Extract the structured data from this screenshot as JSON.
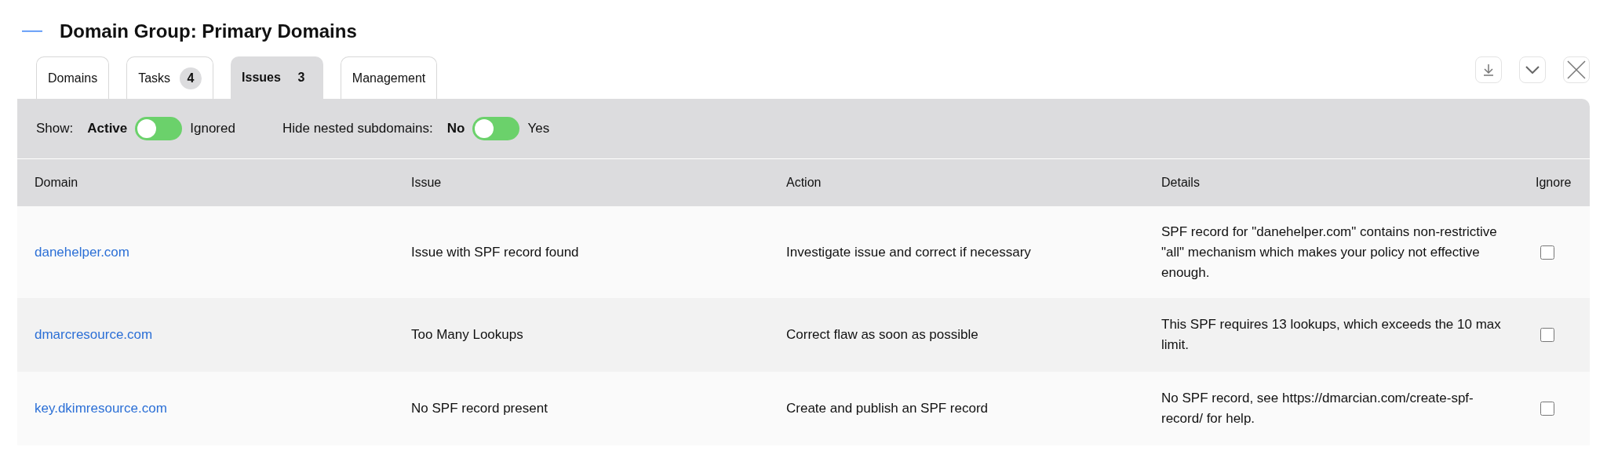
{
  "header": {
    "title": "Domain Group: Primary Domains"
  },
  "tabs": [
    {
      "label": "Domains",
      "selected": false
    },
    {
      "label": "Tasks",
      "count": "4",
      "selected": false
    },
    {
      "label": "Issues",
      "count": "3",
      "selected": true
    },
    {
      "label": "Management",
      "selected": false
    }
  ],
  "filters": [
    {
      "label": "Show:",
      "options": [
        {
          "label": "Active",
          "selected": true
        },
        {
          "label": "Ignored",
          "selected": false
        }
      ]
    },
    {
      "label": "Hide nested subdomains:",
      "options": [
        {
          "label": "No",
          "selected": true
        },
        {
          "label": "Yes",
          "selected": false
        }
      ]
    }
  ],
  "table": {
    "columns": [
      "Domain",
      "Issue",
      "Action",
      "Details",
      "Ignore"
    ],
    "rows": [
      {
        "domain": "danehelper.com",
        "issue": "Issue with SPF record found",
        "action": "Investigate issue and correct if necessary",
        "details": "SPF record for \"danehelper.com\" contains non-restrictive \"all\" mechanism which makes your policy not effective enough.",
        "ignored": false
      },
      {
        "domain": "dmarcresource.com",
        "issue": "Too Many Lookups",
        "action": "Correct flaw as soon as possible",
        "details": "This SPF requires 13 lookups, which exceeds the 10 max limit.",
        "ignored": false
      },
      {
        "domain": "key.dkimresource.com",
        "issue": "No SPF record present",
        "action": "Create and publish an SPF record",
        "details": "No SPF record, see https://dmarcian.com/create-spf-record/ for help.",
        "ignored": false
      }
    ]
  }
}
